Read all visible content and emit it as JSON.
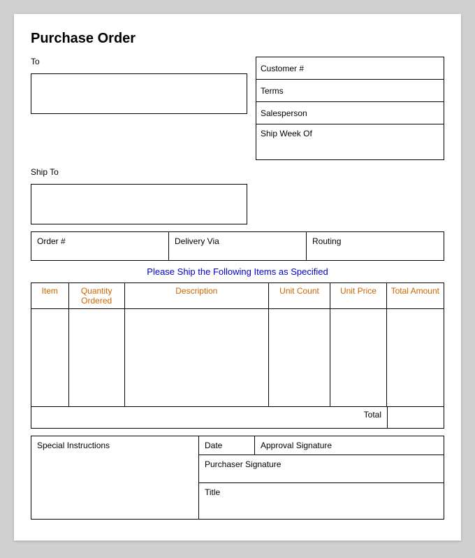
{
  "title": "Purchase Order",
  "to_label": "To",
  "ship_to_label": "Ship To",
  "customer_label": "Customer #",
  "terms_label": "Terms",
  "salesperson_label": "Salesperson",
  "ship_week_of_label": "Ship Week Of",
  "order_num_label": "Order #",
  "delivery_via_label": "Delivery Via",
  "routing_label": "Routing",
  "center_text": "Please Ship the Following Items as Specified",
  "table_headers": {
    "item": "Item",
    "quantity_ordered": "Quantity Ordered",
    "description": "Description",
    "unit_count": "Unit Count",
    "unit_price": "Unit Price",
    "total_amount": "Total Amount"
  },
  "total_label": "Total",
  "special_instructions_label": "Special Instructions",
  "date_label": "Date",
  "approval_signature_label": "Approval Signature",
  "purchaser_signature_label": "Purchaser Signature",
  "title_label": "Title"
}
